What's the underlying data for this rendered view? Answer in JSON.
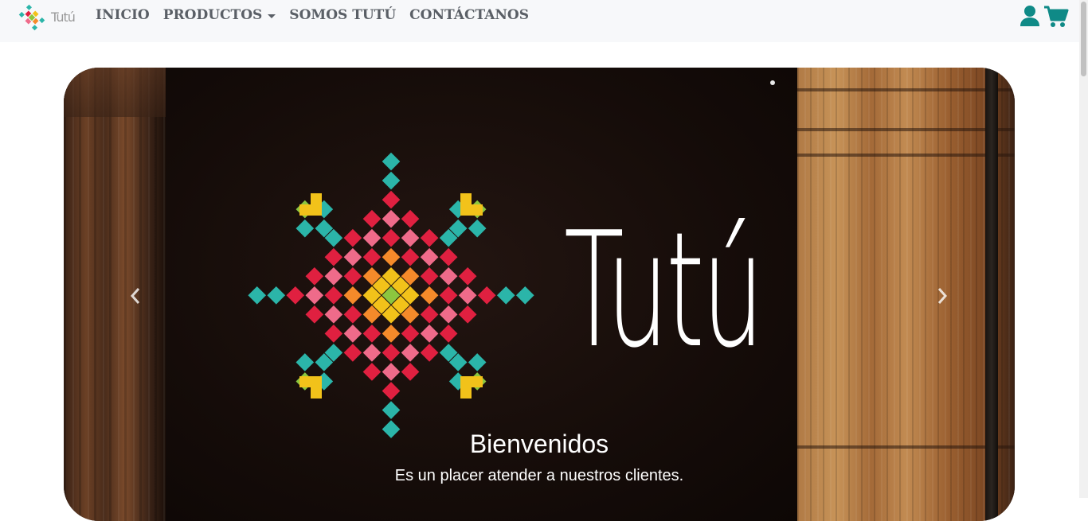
{
  "brand": {
    "logo_text": "Tutú",
    "logo_icon": "tutu-emblem-icon"
  },
  "nav": {
    "links": [
      {
        "label": "INICIO"
      },
      {
        "label": "PRODUCTOS",
        "dropdown": true
      },
      {
        "label": "SOMOS TUTÚ"
      },
      {
        "label": "CONTÁCTANOS"
      }
    ],
    "icons": [
      "user-icon",
      "shopping-cart-icon"
    ],
    "icon_color": "#0f8a87"
  },
  "hero": {
    "wordmark": "Tutú",
    "caption_title": "Bienvenidos",
    "caption_text": "Es un placer atender a nuestros clientes.",
    "prev_icon": "chevron-left-icon",
    "next_icon": "chevron-right-icon"
  },
  "colors": {
    "navbar_bg": "#f7f8fa",
    "nav_text": "#5a5f66",
    "emblem_teal": "#2bb5a9",
    "emblem_red": "#e02040",
    "emblem_yellow": "#f2c21a",
    "emblem_orange": "#f58a2a",
    "emblem_pink": "#ef6b8a",
    "emblem_green": "#8cc63f"
  }
}
